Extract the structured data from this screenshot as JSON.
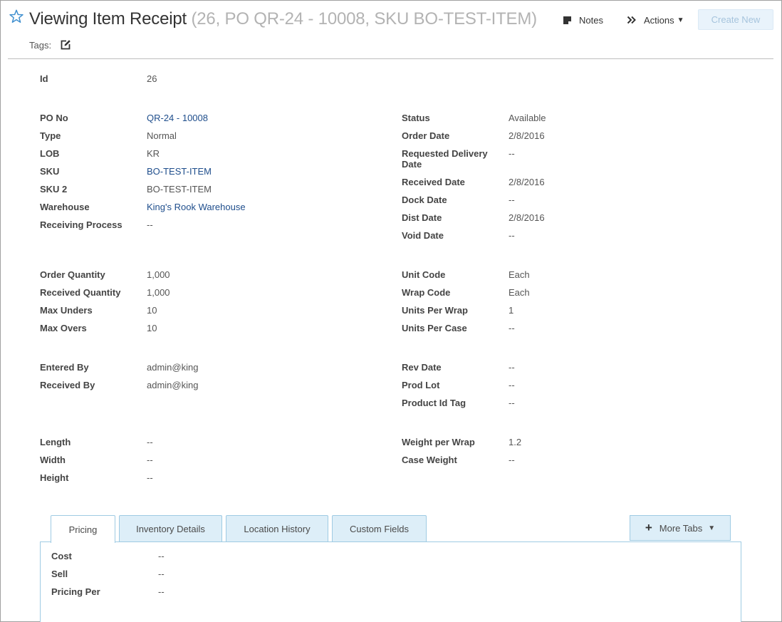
{
  "header": {
    "title": "Viewing Item Receipt",
    "subtitle": "(26, PO QR-24 - 10008, SKU BO-TEST-ITEM)",
    "notes_label": "Notes",
    "actions_label": "Actions",
    "create_label": "Create New",
    "tags_label": "Tags:"
  },
  "fields": {
    "id": {
      "label": "Id",
      "value": "26"
    },
    "po_no": {
      "label": "PO No",
      "value": "QR-24 - 10008"
    },
    "type": {
      "label": "Type",
      "value": "Normal"
    },
    "lob": {
      "label": "LOB",
      "value": "KR"
    },
    "sku": {
      "label": "SKU",
      "value": "BO-TEST-ITEM"
    },
    "sku2": {
      "label": "SKU 2",
      "value": "BO-TEST-ITEM"
    },
    "warehouse": {
      "label": "Warehouse",
      "value": "King's Rook Warehouse"
    },
    "receiving_process": {
      "label": "Receiving Process",
      "value": "--"
    },
    "status": {
      "label": "Status",
      "value": "Available"
    },
    "order_date": {
      "label": "Order Date",
      "value": "2/8/2016"
    },
    "requested_delivery_date": {
      "label": "Requested Delivery Date",
      "value": "--"
    },
    "received_date": {
      "label": "Received Date",
      "value": "2/8/2016"
    },
    "dock_date": {
      "label": "Dock Date",
      "value": "--"
    },
    "dist_date": {
      "label": "Dist Date",
      "value": "2/8/2016"
    },
    "void_date": {
      "label": "Void Date",
      "value": "--"
    },
    "order_quantity": {
      "label": "Order Quantity",
      "value": "1,000"
    },
    "received_quantity": {
      "label": "Received Quantity",
      "value": "1,000"
    },
    "max_unders": {
      "label": "Max Unders",
      "value": "10"
    },
    "max_overs": {
      "label": "Max Overs",
      "value": "10"
    },
    "unit_code": {
      "label": "Unit Code",
      "value": "Each"
    },
    "wrap_code": {
      "label": "Wrap Code",
      "value": "Each"
    },
    "units_per_wrap": {
      "label": "Units Per Wrap",
      "value": "1"
    },
    "units_per_case": {
      "label": "Units Per Case",
      "value": "--"
    },
    "entered_by": {
      "label": "Entered By",
      "value": "admin@king"
    },
    "received_by": {
      "label": "Received By",
      "value": "admin@king"
    },
    "rev_date": {
      "label": "Rev Date",
      "value": "--"
    },
    "prod_lot": {
      "label": "Prod Lot",
      "value": "--"
    },
    "product_id_tag": {
      "label": "Product Id Tag",
      "value": "--"
    },
    "length": {
      "label": "Length",
      "value": "--"
    },
    "width": {
      "label": "Width",
      "value": "--"
    },
    "height": {
      "label": "Height",
      "value": "--"
    },
    "weight_per_wrap": {
      "label": "Weight per Wrap",
      "value": "1.2"
    },
    "case_weight": {
      "label": "Case Weight",
      "value": "--"
    }
  },
  "tabs": {
    "pricing": "Pricing",
    "inventory_details": "Inventory Details",
    "location_history": "Location History",
    "custom_fields": "Custom Fields",
    "more_tabs": "More Tabs"
  },
  "pricing": {
    "cost": {
      "label": "Cost",
      "value": "--"
    },
    "sell": {
      "label": "Sell",
      "value": "--"
    },
    "pricing_per": {
      "label": "Pricing Per",
      "value": "--"
    }
  },
  "icons": {
    "favorite": "star-icon",
    "notes": "notes-icon",
    "actions": "double-chevron-right-icon",
    "tags_edit": "edit-icon",
    "more_tabs": "plus-icon"
  },
  "colors": {
    "link": "#1f4e8c",
    "star": "#3f8fcf",
    "tab_bg": "#ddeef8",
    "tab_border": "#9fcbe3",
    "create_bg": "#e9f3fb"
  }
}
